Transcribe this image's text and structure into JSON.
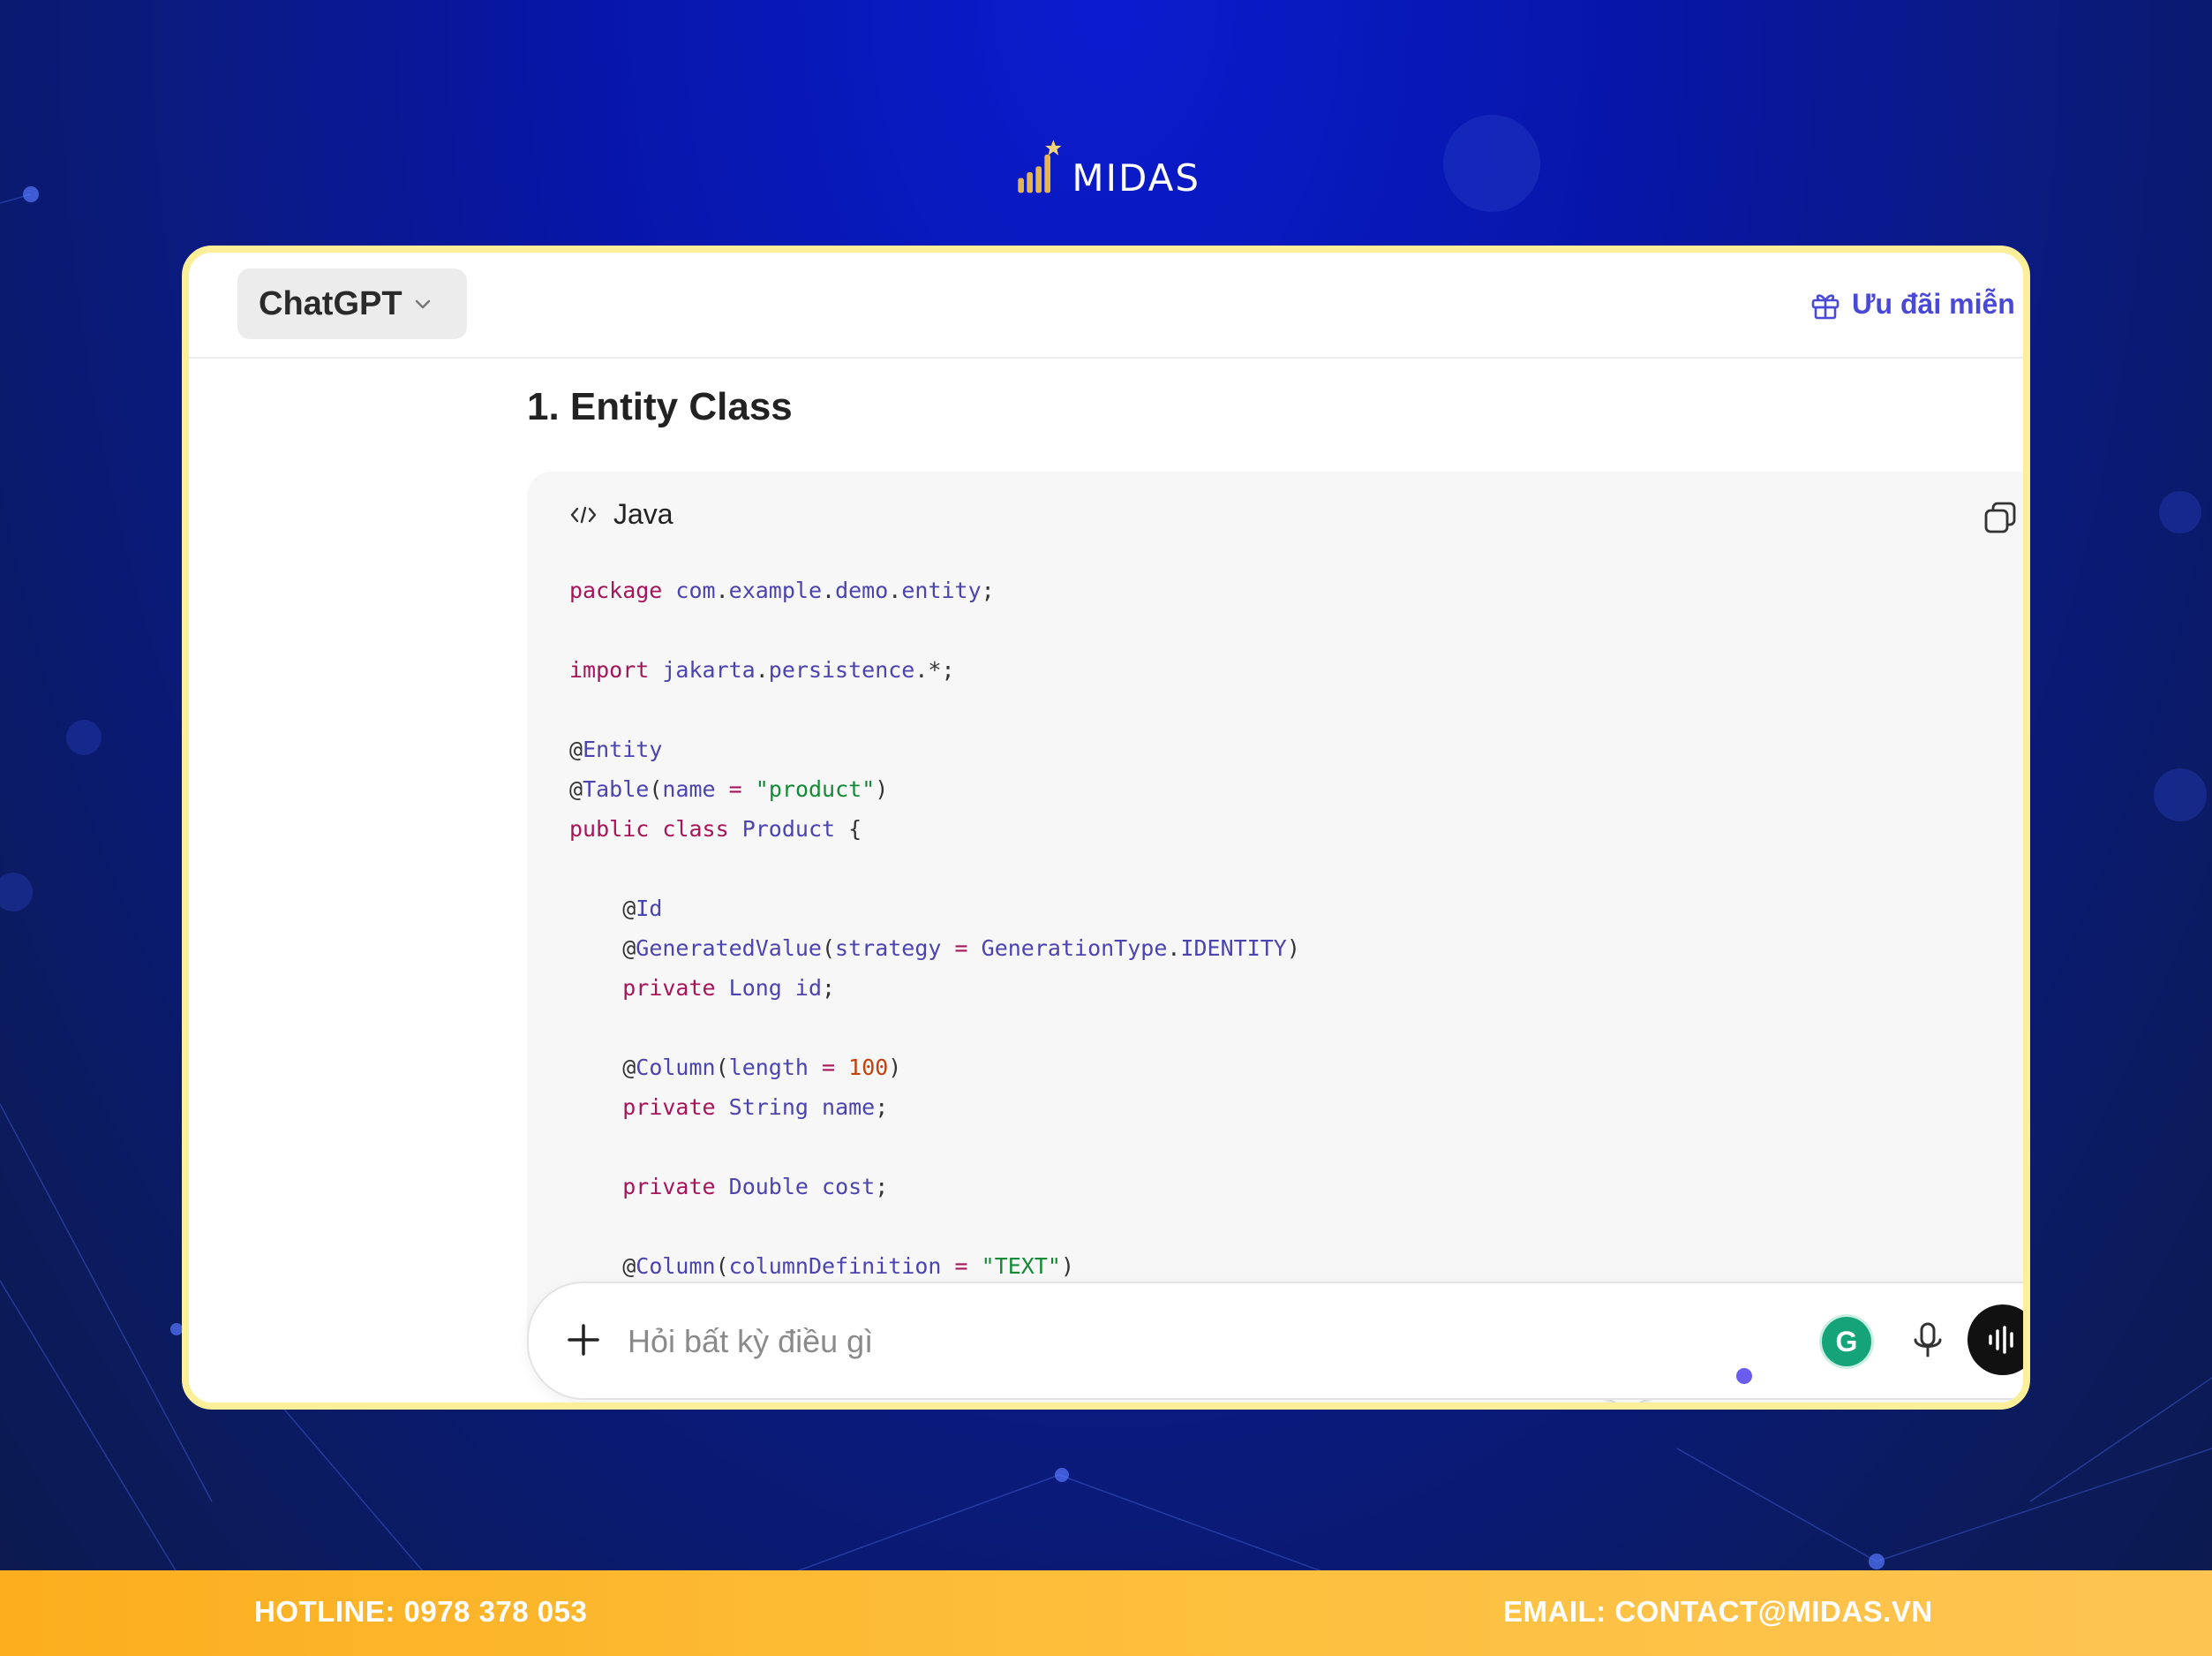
{
  "brand": {
    "name": "MIDAS"
  },
  "header": {
    "model_label": "ChatGPT",
    "promo_label": "Ưu đãi miễn p"
  },
  "content": {
    "section_title": "1. Entity Class",
    "code_block": {
      "language": "Java",
      "lines": [
        "package com.example.demo.entity;",
        "",
        "import jakarta.persistence.*;",
        "",
        "@Entity",
        "@Table(name = \"product\")",
        "public class Product {",
        "",
        "    @Id",
        "    @GeneratedValue(strategy = GenerationType.IDENTITY)",
        "    private Long id;",
        "",
        "    @Column(length = 100)",
        "    private String name;",
        "",
        "    private Double cost;",
        "",
        "    @Column(columnDefinition = \"TEXT\")"
      ]
    }
  },
  "composer": {
    "placeholder": "Hỏi bất kỳ điều gì"
  },
  "icons": [
    "chevron-down-icon",
    "gift-icon",
    "code-icon",
    "copy-icon",
    "arrow-down-icon",
    "plus-icon",
    "grammarly-icon",
    "microphone-icon",
    "voice-mode-icon"
  ],
  "footer": {
    "hotline": "HOTLINE: 0978 378 053",
    "email": "EMAIL: CONTACT@MIDAS.VN"
  },
  "colors": {
    "accent": "#4a48d6",
    "frame": "#fbef9a",
    "footer": "#fdbf3b"
  }
}
